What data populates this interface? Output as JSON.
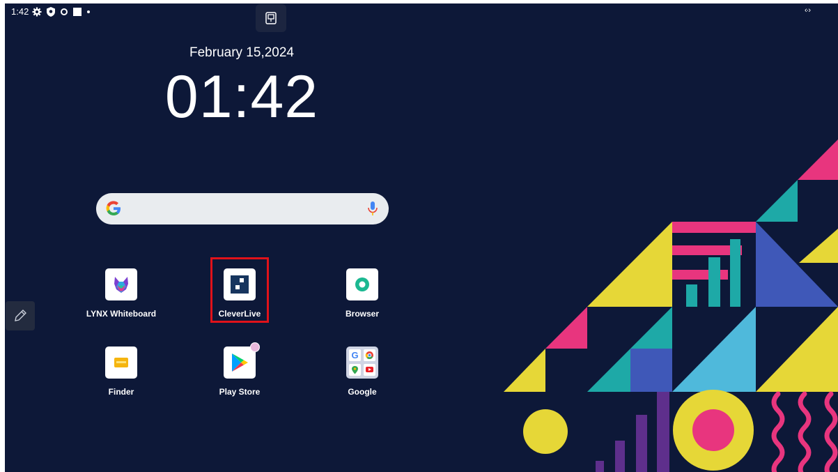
{
  "status_bar": {
    "time": "1:42",
    "icons": [
      "gear-icon",
      "shield-icon",
      "circle-dot-icon",
      "square-icon",
      "dot-icon"
    ],
    "right_indicator": "‹·›"
  },
  "date": "February 15,2024",
  "clock": "01:42",
  "search": {
    "logo": "google-g-icon",
    "mic": "mic-icon"
  },
  "apps": [
    {
      "label": "LYNX Whiteboard",
      "icon": "lynx-whiteboard-icon"
    },
    {
      "label": "CleverLive",
      "icon": "cleverlive-icon",
      "highlighted": true
    },
    {
      "label": "Browser",
      "icon": "browser-icon"
    },
    {
      "label": "Finder",
      "icon": "finder-icon"
    },
    {
      "label": "Play Store",
      "icon": "play-store-icon",
      "badge": true
    },
    {
      "label": "Google",
      "icon": "google-folder-icon"
    }
  ],
  "colors": {
    "background": "#0d1838",
    "highlight": "#e0121a",
    "pink": "#e8357e",
    "yellow": "#e6d737",
    "teal": "#1ea9a7",
    "blue": "#3f58b8",
    "light_blue": "#4fb9db",
    "purple": "#5e2f8c"
  }
}
